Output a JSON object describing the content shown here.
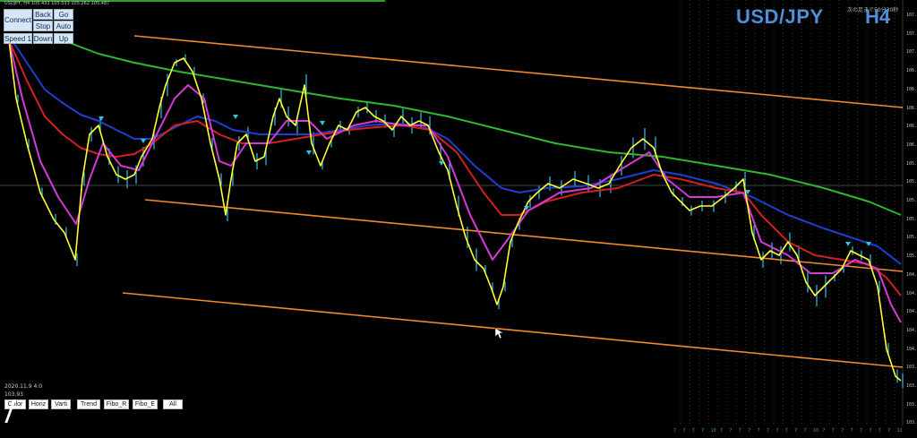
{
  "window": {
    "symbol_info": "USDJPY, H4   105.431  105.533  105.262  105.487"
  },
  "controls": {
    "connect": "Connect",
    "back": "Back",
    "go": "Go",
    "stop": "Stop",
    "auto": "Auto",
    "speed": "Speed 1",
    "down": "Down",
    "up": "Up"
  },
  "header": {
    "pair": "USD/JPY",
    "timeframe": "H4",
    "note": "次の足まで50分30秒"
  },
  "y_axis": {
    "labels": [
      "107.5",
      "107.2",
      "107.0",
      "106.8",
      "106.6",
      "106.4",
      "106.2",
      "106.0",
      "105.8",
      "105.6",
      "105.5",
      "105.4",
      "105.2",
      "105.0",
      "104.8",
      "104.6",
      "104.4",
      "104.2",
      "104.0",
      "103.8",
      "103.6",
      "103.4",
      "103.2"
    ]
  },
  "status": {
    "date": "2020.11.9 4:0",
    "price": "103.93"
  },
  "toolbar": {
    "color": "Color",
    "horiz": "Horiz",
    "vertical": "Varti",
    "trend": "Trend",
    "fibo_r": "Fibo_R",
    "fibo_e": "Fibo_E",
    "all": "All"
  },
  "bottom_ticks": [
    "7",
    "7",
    "7",
    "7",
    "10",
    "7",
    "7",
    "7",
    "7",
    "7",
    "7",
    "7",
    "7",
    "7",
    "7",
    "10",
    "7",
    "7",
    "7",
    "7",
    "7",
    "7",
    "7",
    "7",
    "12"
  ],
  "colors": {
    "background": "#000000",
    "channel": "#f08a2a",
    "green_ma": "#2eb82e",
    "blue_ma": "#1e3fd0",
    "red_ma": "#d42020",
    "magenta_ma": "#d43ad4",
    "yellow_ma": "#ffff33",
    "candles": "#2ec4e8",
    "title": "#4f8fd9"
  }
}
